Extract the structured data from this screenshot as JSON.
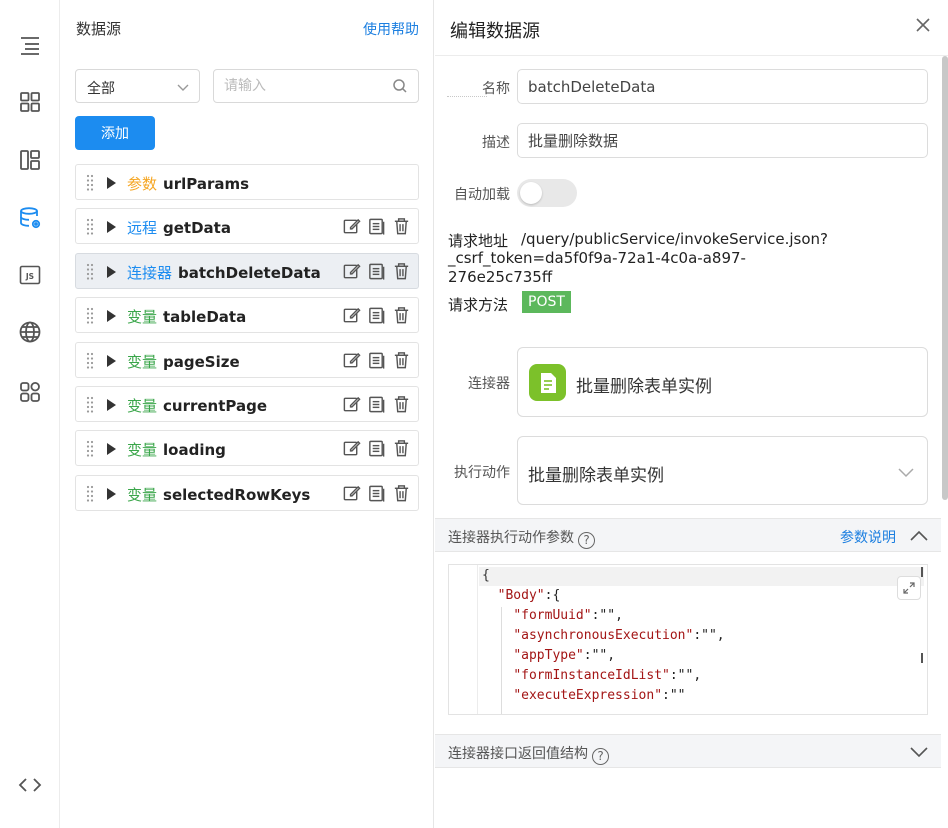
{
  "rail": {
    "items": [
      "outline-icon",
      "components-icon",
      "layout-icon",
      "datasource-icon",
      "js-icon",
      "globe-icon",
      "apps-icon",
      "code-icon"
    ],
    "js_label": "JS"
  },
  "datasource": {
    "title": "数据源",
    "help": "使用帮助",
    "filter_value": "全部",
    "search_placeholder": "请输入",
    "add_label": "添加",
    "items": [
      {
        "tag": "参数",
        "name": "urlParams",
        "tag_color": "#f5a623",
        "actions": false
      },
      {
        "tag": "远程",
        "name": "getData",
        "tag_color": "#1c8cf0",
        "actions": true
      },
      {
        "tag": "连接器",
        "name": "batchDeleteData",
        "tag_color": "#1c8cf0",
        "actions": true
      },
      {
        "tag": "变量",
        "name": "tableData",
        "tag_color": "#3aa64a",
        "actions": true
      },
      {
        "tag": "变量",
        "name": "pageSize",
        "tag_color": "#3aa64a",
        "actions": true
      },
      {
        "tag": "变量",
        "name": "currentPage",
        "tag_color": "#3aa64a",
        "actions": true
      },
      {
        "tag": "变量",
        "name": "loading",
        "tag_color": "#3aa64a",
        "actions": true
      },
      {
        "tag": "变量",
        "name": "selectedRowKeys",
        "tag_color": "#3aa64a",
        "actions": true
      }
    ]
  },
  "editor": {
    "title": "编辑数据源",
    "name_label": "名称",
    "name_value": "batchDeleteData",
    "desc_label": "描述",
    "desc_value": "批量删除数据",
    "autoload_label": "自动加载",
    "url_label": "请求地址",
    "url_value": "/query/publicService/invokeService.json?_csrf_token=da5f0f9a-72a1-4c0a-a897-276e25c735ff",
    "method_label": "请求方法",
    "method_value": "POST",
    "connector_label": "连接器",
    "connector_value": "批量删除表单实例",
    "action_label": "执行动作",
    "action_value": "批量删除表单实例",
    "params_section": "连接器执行动作参数",
    "params_link": "参数说明",
    "code_lines": [
      "{",
      "  \"Body\":{",
      "    \"formUuid\":\"\",",
      "    \"asynchronousExecution\":\"\",",
      "    \"appType\":\"\",",
      "    \"formInstanceIdList\":\"\",",
      "    \"executeExpression\":\"\""
    ],
    "return_section": "连接器接口返回值结构"
  }
}
